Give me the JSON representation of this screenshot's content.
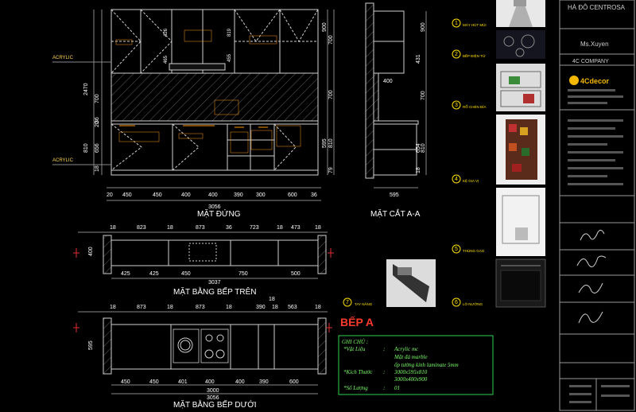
{
  "elevation": {
    "title": "MẶT ĐỨNG",
    "material_label_top": "ACRYLIC",
    "material_label_bottom": "ACRYLIC",
    "left_dims": [
      "2470",
      "700",
      "20",
      "36",
      "810",
      "656",
      "18"
    ],
    "right_dims_top": [
      "900",
      "436",
      "900",
      "445",
      "10",
      "300",
      "290",
      "300"
    ],
    "right_dims_side": [
      "700",
      "700",
      "595",
      "810",
      "79",
      "36"
    ],
    "bottom_dims": [
      "20",
      "450",
      "450",
      "400",
      "400",
      "390",
      "300",
      "600",
      "36"
    ],
    "total_width": "3056",
    "inner_upper_dims": [
      "426",
      "819",
      "455",
      "465"
    ]
  },
  "section": {
    "title": "MẶT CẮT A-A",
    "dims": [
      "900",
      "431",
      "700",
      "400",
      "810",
      "654",
      "18",
      "595"
    ]
  },
  "plan_upper": {
    "title": "MẶT BẰNG BẾP TRÊN",
    "top_dims": [
      "18",
      "823",
      "18",
      "873",
      "36",
      "723",
      "18",
      "473",
      "18"
    ],
    "bottom_dims": [
      "425",
      "425",
      "450",
      "750",
      "500"
    ],
    "total": "3037",
    "side": "400"
  },
  "plan_lower": {
    "title": "MẶT BẰNG BẾP DƯỚI",
    "top_dims": [
      "18",
      "873",
      "18",
      "873",
      "18",
      "390",
      "18",
      "563",
      "18"
    ],
    "top_small": "18",
    "bottom_dims": [
      "450",
      "450",
      "401",
      "400",
      "400",
      "390",
      "600"
    ],
    "total_inner": "3000",
    "total": "3056",
    "side": "595"
  },
  "catalog": [
    {
      "num": "1",
      "label": "MÁY HÚT MÙI"
    },
    {
      "num": "2",
      "label": "BẾP ĐIỆN TỪ"
    },
    {
      "num": "3",
      "label": "RỔ CHÉN ĐĨA"
    },
    {
      "num": "4",
      "label": "KỆ GIA VỊ"
    },
    {
      "num": "5",
      "label": "THÙNG GẠO"
    },
    {
      "num": "6",
      "label": "LÒ NƯỚNG"
    },
    {
      "num": "7",
      "label": "TAY NÂNG"
    }
  ],
  "drawing_title": "BẾP A",
  "notes": {
    "heading": "GHI CHÚ :",
    "rows": [
      {
        "key": "*Vật Liệu",
        "sep": ":",
        "vals": [
          "Acrylic mc",
          "Mặt đá marble",
          "ốp tường kính laminate 5mm"
        ]
      },
      {
        "key": "*Kích Thước",
        "sep": ":",
        "vals": [
          "3000x595x810",
          "3000x400x900"
        ]
      },
      {
        "key": "*Số Lượng",
        "sep": ":",
        "vals": [
          "01"
        ]
      }
    ]
  },
  "title_block": {
    "project": "HÀ ĐÔ CENTROSA",
    "client": "Ms.Xuyen",
    "company": "4C COMPANY",
    "logo_text": "4Cdecor"
  }
}
